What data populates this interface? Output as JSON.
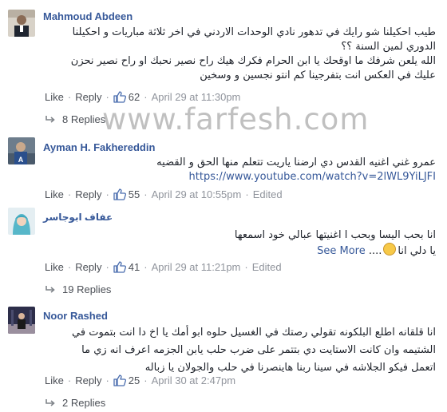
{
  "comments": [
    {
      "author": "Mahmoud Abdeen",
      "lines": [
        "طيب احكيلنا شو رايك في تدهور نادي الوحدات الاردني في اخر ثلاثة مباريات و احكيلنا",
        "الدوري لمين السنة ؟؟",
        "الله يلعن شرفك ما اوقحك يا ابن الحرام فكرك هيك راح نصير نحبك او راح نصير نحزن",
        "عليك في العكس انت بتفرجينا كم انتو نجسين و وسخين"
      ],
      "like": "Like",
      "reply": "Reply",
      "likes": "62",
      "time": "April 29 at 11:30pm",
      "replies": "8 Replies"
    },
    {
      "author": "Ayman H. Fakhereddin",
      "lines": [
        "عمرو غني اغنيه القدس دي ارضنا ياريت تتعلم منها الحق و القضيه"
      ],
      "url": "https://www.youtube.com/watch?v=2lWL9YiLJFI",
      "like": "Like",
      "reply": "Reply",
      "likes": "55",
      "time": "April 29 at 10:55pm",
      "edited": "Edited"
    },
    {
      "author": "عفاف ابوجاسر",
      "lines": [
        "انا بحب اليسا وبحب ا اغنيتها عبالي خود اسمعها",
        "يا دلي انا"
      ],
      "see_more": "See More",
      "like": "Like",
      "reply": "Reply",
      "likes": "41",
      "time": "April 29 at 11:21pm",
      "edited": "Edited",
      "replies": "19 Replies"
    },
    {
      "author": "Noor Rashed",
      "lines": [
        "انا قلقانه اطلع البلكونه تقولي رصتك في الغسيل حلوه ابو أمك يا اخ دا انت بتموت في",
        "الشتيمه وان كانت الاستايت دي بتتمر على ضرب حلب يابن الجزمه اعرف انه زي ما",
        "اتعمل فيكو الجلاشه في سينا ربنا هاينصرنا في حلب والجولان يا زباله"
      ],
      "like": "Like",
      "reply": "Reply",
      "likes": "25",
      "time": "April 30 at 2:47pm",
      "replies": "2 Replies"
    }
  ],
  "watermark": "www.farfesh.com",
  "colors": {
    "link": "#365899",
    "meta": "#90949c",
    "text": "#1d2129"
  },
  "icons": {
    "like": "thumbs-up-icon",
    "reply": "reply-arrow-icon"
  }
}
